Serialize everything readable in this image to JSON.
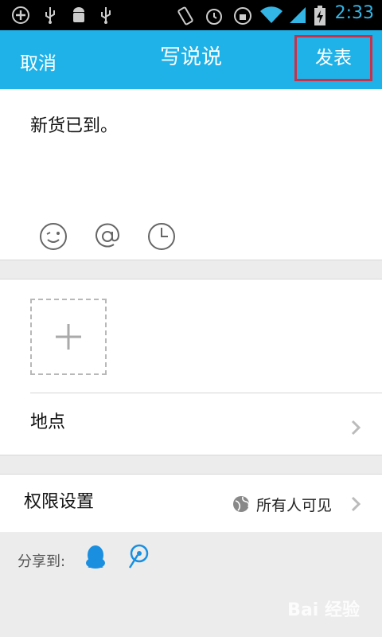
{
  "status_bar": {
    "time": "2:33"
  },
  "title_bar": {
    "cancel": "取消",
    "title": "写说说",
    "publish": "发表"
  },
  "compose": {
    "text": "新货已到。"
  },
  "location": {
    "label": "地点"
  },
  "permission": {
    "label": "权限设置",
    "value": "所有人可见"
  },
  "share": {
    "label": "分享到:"
  },
  "watermark": {
    "text": "Bai 经验"
  },
  "colors": {
    "accent": "#1fb2e8",
    "highlight_border": "#c9304a",
    "share_icon": "#1a8fe0"
  }
}
